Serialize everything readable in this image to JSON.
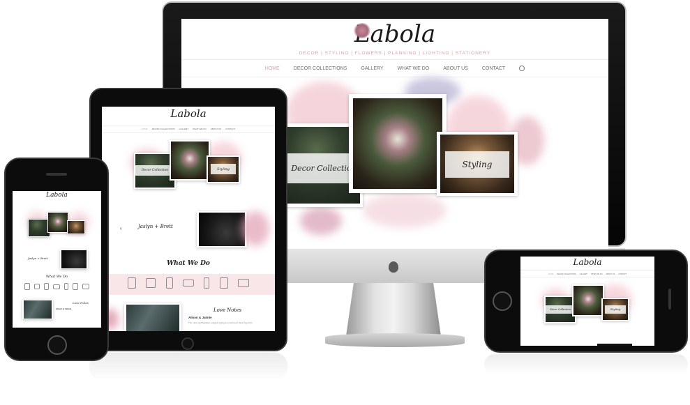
{
  "brand": {
    "logo": "Labola",
    "tagline": "DECOR | STYLING | FLOWERS | PLANNING | LIGHTING | STATIONERY"
  },
  "nav": {
    "items": [
      "HOME",
      "DECOR COLLECTIONS",
      "GALLERY",
      "WHAT WE DO",
      "ABOUT US",
      "CONTACT"
    ],
    "active_index": 0,
    "search_icon": "search-icon"
  },
  "hero": {
    "cards": [
      {
        "label": "Decor Collection"
      },
      {
        "label": "Styling"
      }
    ]
  },
  "sections": {
    "tablet_slider_script": "Jaslyn + Brett",
    "what_we_do": "What We Do",
    "love_notes": "Love Notes",
    "testimonial_name": "Alison & Jaimie",
    "testimonial_text": "The most sophisticated, elegant styling we could ever have hoped for",
    "slider_prev_icon": "chevron-left-icon"
  },
  "colors": {
    "accent_pink": "#e59aa6",
    "bezel": "#0c0c0c",
    "band_pink": "#f8e6e8"
  }
}
